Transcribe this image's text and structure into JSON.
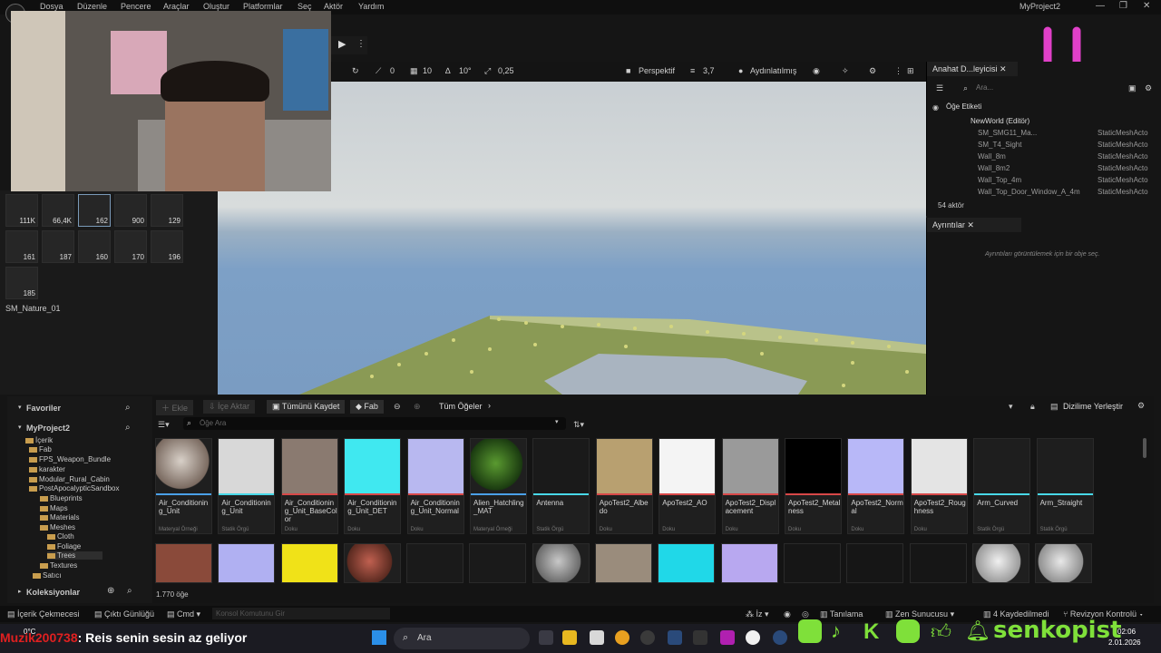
{
  "menu": {
    "items": [
      "Dosya",
      "Düzenle",
      "Pencere",
      "Araçlar",
      "Oluştur",
      "Platformlar",
      "Seç",
      "Aktör",
      "Yardım"
    ],
    "project": "MyProject2"
  },
  "viewport": {
    "tool1": "0",
    "tool2": "10",
    "tool3": "10°",
    "tool4": "0,25",
    "perspective": "Perspektif",
    "speed": "3,7",
    "lit": "Aydınlatılmış"
  },
  "left": {
    "counts": [
      "111K",
      "66,4K",
      "162",
      "900",
      "129",
      "161",
      "187",
      "160",
      "170",
      "196",
      "185"
    ],
    "selected_label": "SM_Nature_01"
  },
  "outliner": {
    "tab": "Anahat D...leyicisi",
    "search": "Ara...",
    "col_label": "Öğe Etiketi",
    "world": "NewWorld (Editör)",
    "rows": [
      [
        "SM_SMG11_Ma...",
        "StaticMeshActo"
      ],
      [
        "SM_T4_Sight",
        "StaticMeshActo"
      ],
      [
        "Wall_8m",
        "StaticMeshActo"
      ],
      [
        "Wall_8m2",
        "StaticMeshActo"
      ],
      [
        "Wall_Top_4m",
        "StaticMeshActo"
      ],
      [
        "Wall_Top_Door_Window_A_4m",
        "StaticMeshActo"
      ]
    ],
    "count": "54 aktör"
  },
  "details": {
    "tab": "Ayrıntılar",
    "empty": "Ayrıntıları görüntülemek için bir obje seç."
  },
  "cb": {
    "favorites": "Favoriler",
    "project": "MyProject2",
    "collections": "Koleksiyonlar",
    "folders": [
      "İçerik",
      "Fab",
      "FPS_Weapon_Bundle",
      "karakter",
      "Modular_Rural_Cabin",
      "PostApocalypticSandbox",
      "Blueprints",
      "Maps",
      "Materials",
      "Meshes",
      "Cloth",
      "Foliage",
      "Trees",
      "Textures",
      "Satıcı"
    ],
    "add": "Ekle",
    "import": "İçe Aktar",
    "save_all": "Tümünü Kaydet",
    "fab": "Fab",
    "path": "Tüm Öğeler",
    "dock": "Dizilime Yerleştir",
    "search": "Öğe Ara",
    "count": "1.770 öğe",
    "assets": [
      {
        "name": "Air_Conditioning_Unit",
        "type": "Materyal Örneği"
      },
      {
        "name": "Air_Conditioning_Unit",
        "type": "Statik Örgü"
      },
      {
        "name": "Air_Conditioning_Unit_BaseColor",
        "type": "Doku"
      },
      {
        "name": "Air_Conditioning_Unit_DET",
        "type": "Doku"
      },
      {
        "name": "Air_Conditioning_Unit_Normal",
        "type": "Doku"
      },
      {
        "name": "Alien_Hatchling_MAT",
        "type": "Materyal Örneği"
      },
      {
        "name": "Antenna",
        "type": "Statik Örgü"
      },
      {
        "name": "ApoTest2_Albedo",
        "type": "Doku"
      },
      {
        "name": "ApoTest2_AO",
        "type": "Doku"
      },
      {
        "name": "ApoTest2_Displacement",
        "type": "Doku"
      },
      {
        "name": "ApoTest2_Metalness",
        "type": "Doku"
      },
      {
        "name": "ApoTest2_Normal",
        "type": "Doku"
      },
      {
        "name": "ApoTest2_Roughness",
        "type": "Doku"
      },
      {
        "name": "Arm_Curved",
        "type": "Statik Örgü"
      },
      {
        "name": "Arm_Straight",
        "type": "Statik Örgü"
      }
    ]
  },
  "status": {
    "content_drawer": "İçerik Çekmecesi",
    "output_log": "Çıktı Günlüğü",
    "cmd": "Cmd",
    "console": "Konsol Komutunu Gir",
    "trace": "İz",
    "diagnostics": "Tanılama",
    "zen": "Zen Sunucusu",
    "saved": "4 Kaydedilmedi",
    "revision": "Revizyon Kontrolü"
  },
  "taskbar": {
    "search": "Ara",
    "temp": "0°C",
    "time": "02:06",
    "date": "2.01.2026"
  },
  "overlay": {
    "user": "Muzik200738",
    "message": ": Reis senin sesin az geliyor",
    "brand": "senkopist"
  }
}
